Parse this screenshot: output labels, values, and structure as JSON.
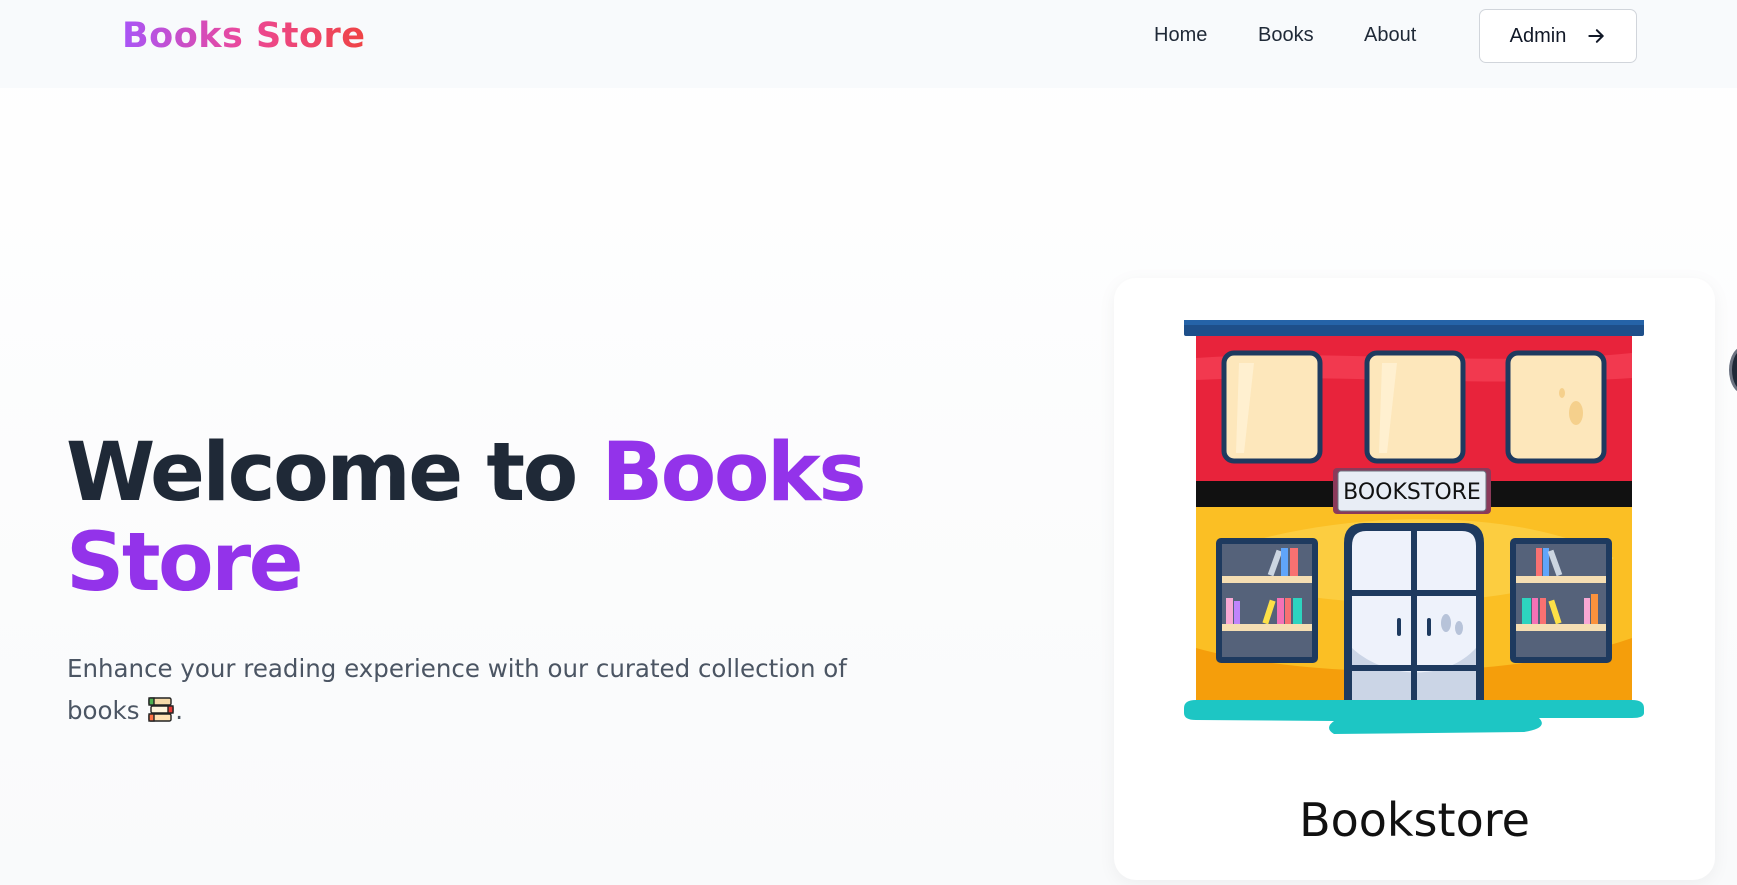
{
  "nav": {
    "brand": "Books Store",
    "links": [
      "Home",
      "Books",
      "About"
    ],
    "admin_label": "Admin"
  },
  "hero": {
    "title_part1": "Welcome to ",
    "title_accent": "Books Store",
    "subtitle": "Enhance your reading experience with our curated collection of books",
    "subtitle_end": "."
  },
  "card": {
    "sign_text": "BOOKSTORE",
    "caption": "Bookstore"
  },
  "icons": {
    "admin_arrow": "arrow-right-icon",
    "books_emoji": "books-icon"
  },
  "colors": {
    "accent": "#9333ea",
    "title": "#1f2937",
    "building_red": "#e8233b",
    "building_yellow": "#fbbf24"
  }
}
